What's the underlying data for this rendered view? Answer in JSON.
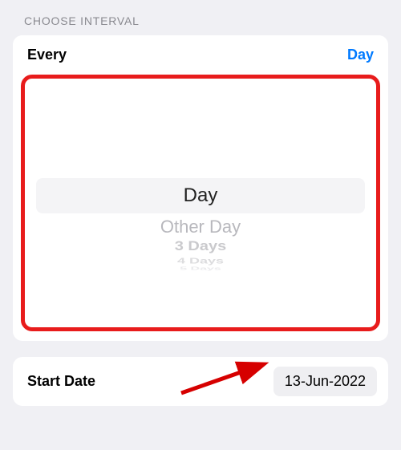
{
  "section": {
    "header": "CHOOSE INTERVAL"
  },
  "interval": {
    "label": "Every",
    "value": "Day",
    "picker": {
      "selected": "Day",
      "options": [
        "Day",
        "Other Day",
        "3 Days",
        "4 Days",
        "5 Days"
      ]
    }
  },
  "startDate": {
    "label": "Start Date",
    "value": "13-Jun-2022"
  },
  "colors": {
    "accent": "#007aff",
    "highlight_border": "#e81c1c",
    "arrow": "#d60000"
  }
}
